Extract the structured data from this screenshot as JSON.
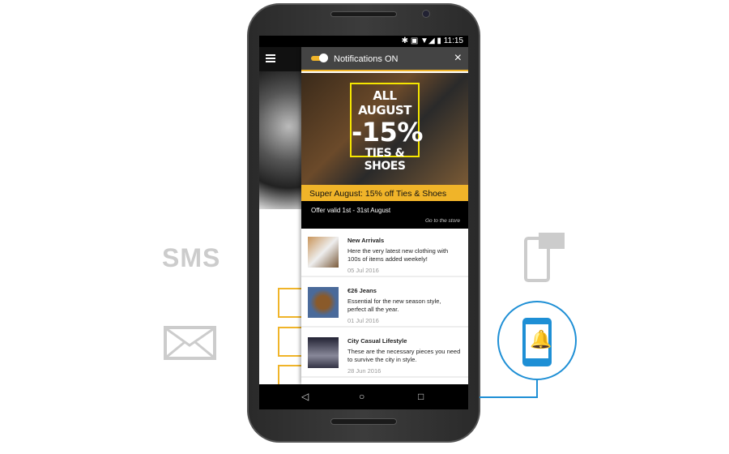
{
  "status_bar": {
    "time": "11:15",
    "icons": "✱ ▣ ▼◢ ▮"
  },
  "notification": {
    "title": "Notifications ON",
    "close_icon": "×"
  },
  "promo": {
    "line1": "ALL AUGUST",
    "line2": "-15%",
    "line3": "TIES & SHOES"
  },
  "banner": "Super August: 15% off Ties & Shoes",
  "offer": {
    "text": "Offer valid 1st - 31st August",
    "link": "Go to the store"
  },
  "items": [
    {
      "title": "New Arrivals",
      "desc": "Here the very latest new clothing with 100s of items added weekely!",
      "date": "05 Jul 2016"
    },
    {
      "title": "€26 Jeans",
      "desc": "Essential for the new season style, perfect all the year.",
      "date": "01 Jul 2016"
    },
    {
      "title": "City Casual Lifestyle",
      "desc": "These are the necessary pieces you need to survive the city in style.",
      "date": "28 Jun 2016"
    }
  ],
  "nav": {
    "back": "◁",
    "home": "○",
    "recent": "□"
  },
  "side": {
    "sms": "SMS",
    "bell": "🔔"
  },
  "colors": {
    "accent": "#f0b429",
    "blue": "#1e8fd5"
  }
}
